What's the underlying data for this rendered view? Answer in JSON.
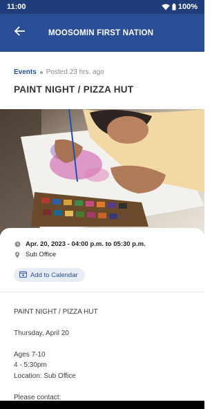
{
  "status_bar": {
    "time": "11:00",
    "battery": "100%"
  },
  "app_bar": {
    "title": "MOOSOMIN FIRST NATION"
  },
  "post": {
    "category": "Events",
    "posted": "Posted 23 hrs. ago",
    "title": "PAINT NIGHT / PIZZA HUT"
  },
  "details": {
    "date": "Apr. 20, 2023 - 04:00 p.m. to 05:30 p.m.",
    "location": "Sub Office",
    "calendar_button": "Add to Calendar"
  },
  "description": {
    "line1": "PAINT NIGHT / PIZZA HUT",
    "line2": "Thursday, April 20",
    "line3": "Ages 7-10",
    "line4": "4 - 5:30pm",
    "line5": "Location: Sub Office",
    "line6": "Please contact:"
  },
  "colors": {
    "primary": "#2a4f97",
    "status_bar": "#1f3d7a",
    "chip_bg": "#e7ecf6"
  },
  "icons": [
    "wifi-icon",
    "battery-icon",
    "back-arrow-icon",
    "clock-icon",
    "location-pin-icon",
    "calendar-add-icon"
  ]
}
